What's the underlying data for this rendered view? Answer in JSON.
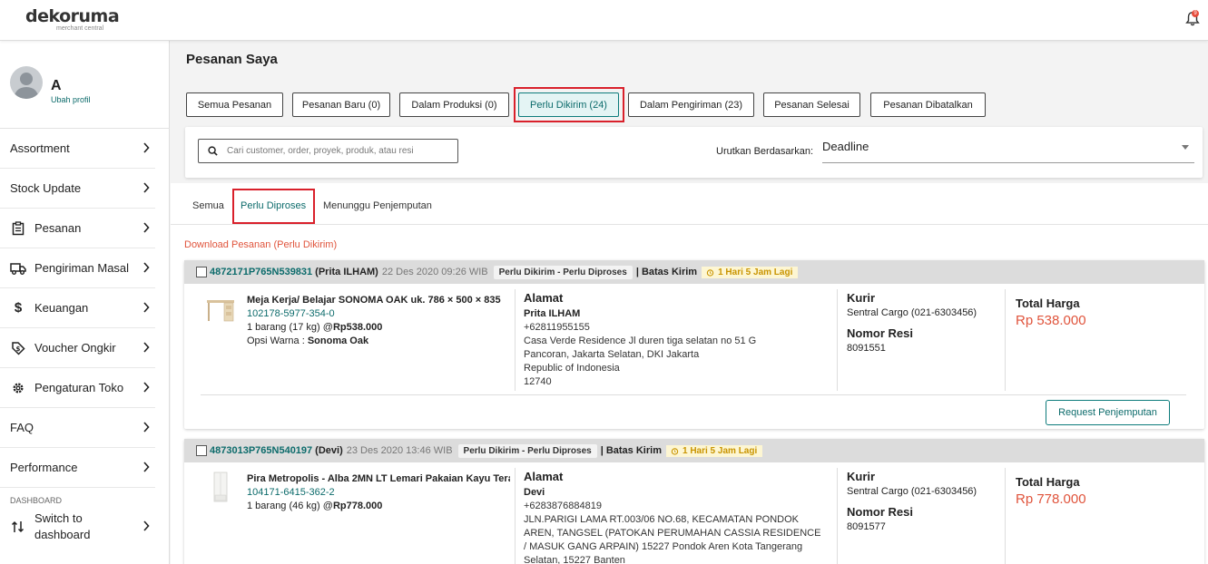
{
  "header": {
    "logo_main": "dekoruma",
    "logo_sub": "merchant central",
    "notification_count": "9"
  },
  "profile": {
    "name": "A",
    "edit_link": "Ubah profil"
  },
  "sidebar": {
    "items": [
      {
        "label": "Assortment",
        "icon": ""
      },
      {
        "label": "Stock Update",
        "icon": ""
      },
      {
        "label": "Pesanan",
        "icon": "clipboard-icon"
      },
      {
        "label": "Pengiriman Masal",
        "icon": "truck-icon"
      },
      {
        "label": "Keuangan",
        "icon": "dollar-icon"
      },
      {
        "label": "Voucher Ongkir",
        "icon": "voucher-icon"
      },
      {
        "label": "Pengaturan Toko",
        "icon": "gear-icon"
      },
      {
        "label": "FAQ",
        "icon": ""
      },
      {
        "label": "Performance",
        "icon": ""
      }
    ],
    "section_label": "DASHBOARD",
    "switch_line1": "Switch to",
    "switch_line2": "dashboard"
  },
  "page": {
    "title": "Pesanan Saya"
  },
  "status_tabs": [
    {
      "label": "Semua Pesanan"
    },
    {
      "label": "Pesanan Baru (0)"
    },
    {
      "label": "Dalam Produksi (0)"
    },
    {
      "label": "Perlu Dikirim (24)",
      "active": true
    },
    {
      "label": "Dalam Pengiriman (23)"
    },
    {
      "label": "Pesanan Selesai"
    },
    {
      "label": "Pesanan Dibatalkan"
    }
  ],
  "filter": {
    "search_placeholder": "Cari customer, order, proyek, produk, atau resi",
    "sort_label": "Urutkan Berdasarkan:",
    "sort_value": "Deadline"
  },
  "sub_tabs": [
    {
      "label": "Semua"
    },
    {
      "label": "Perlu Diproses",
      "active": true
    },
    {
      "label": "Menunggu Penjemputan"
    }
  ],
  "download_link": "Download Pesanan (Perlu Dikirim)",
  "labels": {
    "batas_kirim": "| Batas Kirim",
    "alamat": "Alamat",
    "kurir": "Kurir",
    "nomor_resi": "Nomor Resi",
    "total_harga": "Total Harga",
    "request_pickup": "Request Penjemputan",
    "opsi_warna": "Opsi Warna : "
  },
  "orders": [
    {
      "id": "4872171P765N539831",
      "customer": "(Prita ILHAM)",
      "date": "22 Des 2020 09:26 WIB",
      "status": "Perlu Dikirim - Perlu Diproses",
      "deadline": "1 Hari 5 Jam Lagi",
      "product_name": "Meja Kerja/ Belajar SONOMA OAK uk. 786 × 500 × 835",
      "sku": "102178-5977-354-0",
      "qty": "1 barang (17 kg) @",
      "price": "Rp538.000",
      "color": "Sonoma Oak",
      "recipient": "Prita ILHAM",
      "address_lines": [
        "+62811955155",
        "Casa Verde Residence Jl duren tiga selatan no 51 G",
        "Pancoran, Jakarta Selatan, DKI Jakarta",
        "Republic of Indonesia",
        "12740"
      ],
      "courier": "Sentral Cargo (021-6303456)",
      "resi": "8091551",
      "total": "Rp 538.000"
    },
    {
      "id": "4873013P765N540197",
      "customer": "(Devi)",
      "date": "23 Des 2020 13:46 WIB",
      "status": "Perlu Dikirim - Perlu Diproses",
      "deadline": "1 Hari 5 Jam Lagi",
      "product_name": "Pira Metropolis - Alba 2MN LT Lemari Pakaian Kayu Tera",
      "sku": "104171-6415-362-2",
      "qty": "1 barang (46 kg) @",
      "price": "Rp778.000",
      "recipient": "Devi",
      "address_lines": [
        "+6283876884819",
        "JLN.PARIGI LAMA RT.003/06 NO.68, KECAMATAN PONDOK",
        "AREN, TANGSEL (PATOKAN PERUMAHAN CASSIA RESIDENCE",
        "/ MASUK GANG ARPAIN) 15227 Pondok Aren Kota Tangerang",
        "Selatan, 15227 Banten"
      ],
      "courier": "Sentral Cargo (021-6303456)",
      "resi": "8091577",
      "total": "Rp 778.000"
    }
  ],
  "colors": {
    "accent": "#0c6b6b",
    "price": "#e0543c",
    "highlight": "#d9202b",
    "timer": "#c99400"
  }
}
